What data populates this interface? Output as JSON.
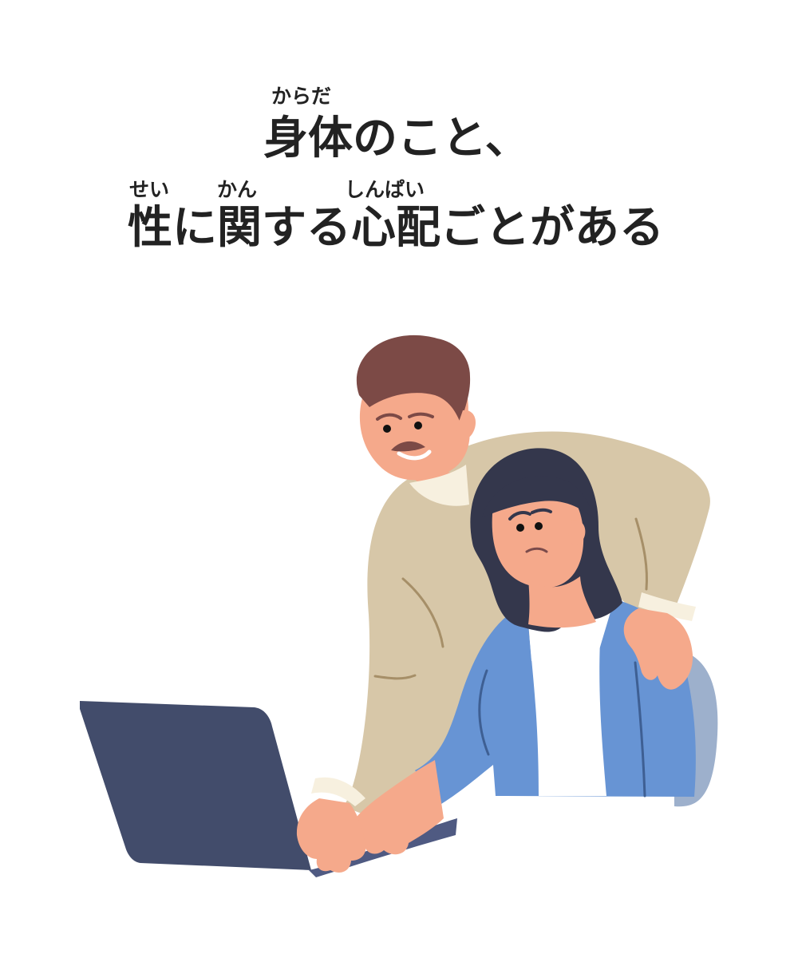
{
  "heading": {
    "line1": "身体のこと、",
    "line2": "性に関する心配ごとがある",
    "furigana": {
      "karada": "からだ",
      "sei": "せい",
      "kan": "かん",
      "shinpai": "しんぱい"
    }
  },
  "illustration": {
    "icon": "couple-at-laptop-illustration",
    "colors": {
      "skin": "#F5A98B",
      "man_hair": "#7C4A46",
      "man_sweater": "#D7C7A8",
      "woman_hair": "#34374C",
      "woman_jacket": "#6794D4",
      "laptop": "#424C6B",
      "laptop_base": "#4F5A82",
      "shirt": "#FFFFFF",
      "collar": "#F7F0DF"
    }
  }
}
